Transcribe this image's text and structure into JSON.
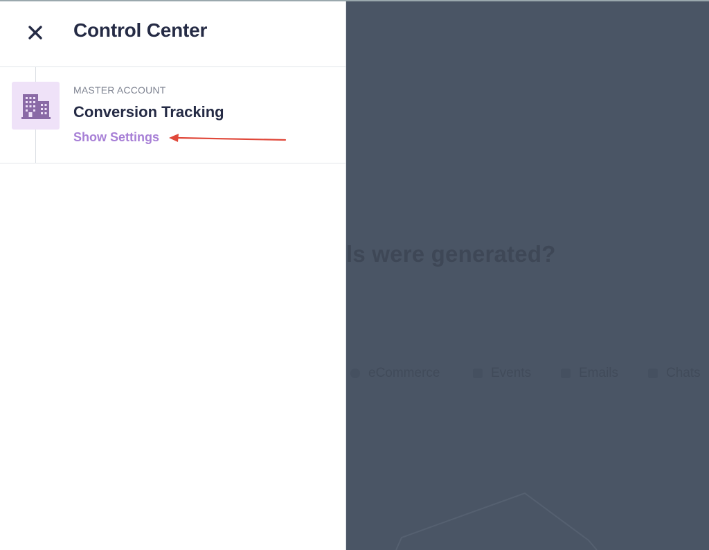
{
  "panel": {
    "title": "Control Center",
    "close_icon": "close-icon",
    "account": {
      "type_label": "MASTER ACCOUNT",
      "name": "Conversion Tracking",
      "link_label": "Show Settings",
      "icon": "building-icon"
    }
  },
  "background": {
    "heading_fragment": "ls were generated?",
    "legend": [
      "eCommerce",
      "Events",
      "Emails",
      "Chats"
    ]
  },
  "colors": {
    "accent": "#a77fd6",
    "title": "#252b45",
    "overlay": "#4a5565",
    "annotation_arrow": "#e0483a"
  }
}
